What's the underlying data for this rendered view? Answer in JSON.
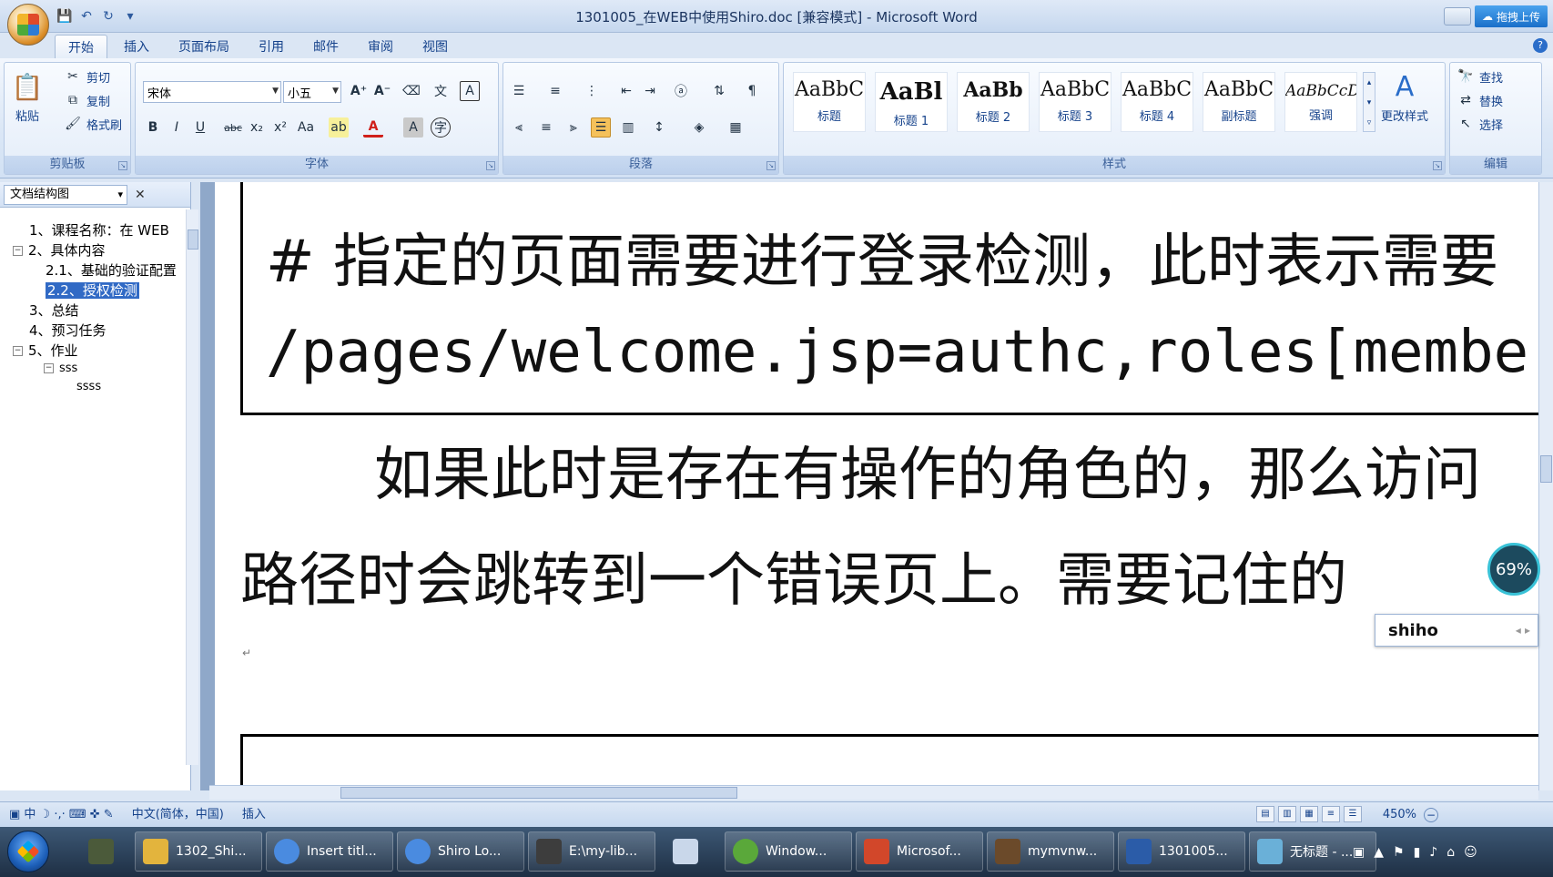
{
  "window": {
    "title": "1301005_在WEB中使用Shiro.doc [兼容模式] - Microsoft Word",
    "upload_button": "拖拽上传"
  },
  "ribbon": {
    "tabs": [
      {
        "label": "开始",
        "active": true
      },
      {
        "label": "插入"
      },
      {
        "label": "页面布局"
      },
      {
        "label": "引用"
      },
      {
        "label": "邮件"
      },
      {
        "label": "审阅"
      },
      {
        "label": "视图"
      }
    ],
    "clipboard": {
      "group": "剪贴板",
      "paste": "粘贴",
      "cut": "剪切",
      "copy": "复制",
      "format_painter": "格式刷"
    },
    "font": {
      "group": "字体",
      "font_name": "宋体",
      "font_size": "小五"
    },
    "paragraph": {
      "group": "段落"
    },
    "styles": {
      "group": "样式",
      "items": [
        {
          "sample": "AaBbC",
          "name": "标题"
        },
        {
          "sample": "AaBl",
          "name": "标题 1"
        },
        {
          "sample": "AaBb",
          "name": "标题 2"
        },
        {
          "sample": "AaBbC",
          "name": "标题 3"
        },
        {
          "sample": "AaBbC",
          "name": "标题 4"
        },
        {
          "sample": "AaBbC",
          "name": "副标题"
        },
        {
          "sample": "AaBbCcD",
          "name": "强调"
        }
      ],
      "change_styles": "更改样式"
    },
    "editing": {
      "group": "编辑",
      "find": "查找",
      "replace": "替换",
      "select": "选择"
    }
  },
  "nav": {
    "title": "文档结构图",
    "items": [
      {
        "label": "1、课程名称：在 WEB",
        "level": 0
      },
      {
        "label": "2、具体内容",
        "level": 0,
        "toggle": "⊟"
      },
      {
        "label": "2.1、基础的验证配置",
        "level": 1
      },
      {
        "label": "2.2、授权检测",
        "level": 1,
        "selected": true
      },
      {
        "label": "3、总结",
        "level": 0
      },
      {
        "label": "4、预习任务",
        "level": 0
      },
      {
        "label": "5、作业",
        "level": 0,
        "toggle": "⊟"
      },
      {
        "label": "sss",
        "level": 1,
        "toggle": "⊟"
      },
      {
        "label": "ssss",
        "level": 2
      }
    ]
  },
  "document": {
    "code_line1": "# 指定的页面需要进行登录检测，此时表示需要",
    "code_line2": "/pages/welcome.jsp=authc,roles[member",
    "para_line1": "如果此时是存在有操作的角色的，那么访问",
    "para_line2": "路径时会跳转到一个错误页上。需要记住的",
    "para_mark": "↵"
  },
  "ime": {
    "text": "shiho"
  },
  "progress": {
    "percent": "69%"
  },
  "statusbar": {
    "language": "中文(简体，中国)",
    "mode": "插入",
    "zoom": "450%"
  },
  "taskbar": {
    "items": [
      {
        "label": "1302_Shi...",
        "color": "#e3b43d"
      },
      {
        "label": "Insert titl...",
        "color": "#4a8be0"
      },
      {
        "label": "Shiro Lo...",
        "color": "#4a8be0"
      },
      {
        "label": "E:\\my-lib...",
        "color": "#3d3d3d"
      },
      {
        "label": "Window...",
        "color": "#5aa83a"
      },
      {
        "label": "Microsof...",
        "color": "#d2472a"
      },
      {
        "label": "mymvnw...",
        "color": "#6b4a2a"
      },
      {
        "label": "1301005...",
        "color": "#2b5ca8"
      },
      {
        "label": "无标题 - ...",
        "color": "#6ab0d8"
      }
    ]
  }
}
